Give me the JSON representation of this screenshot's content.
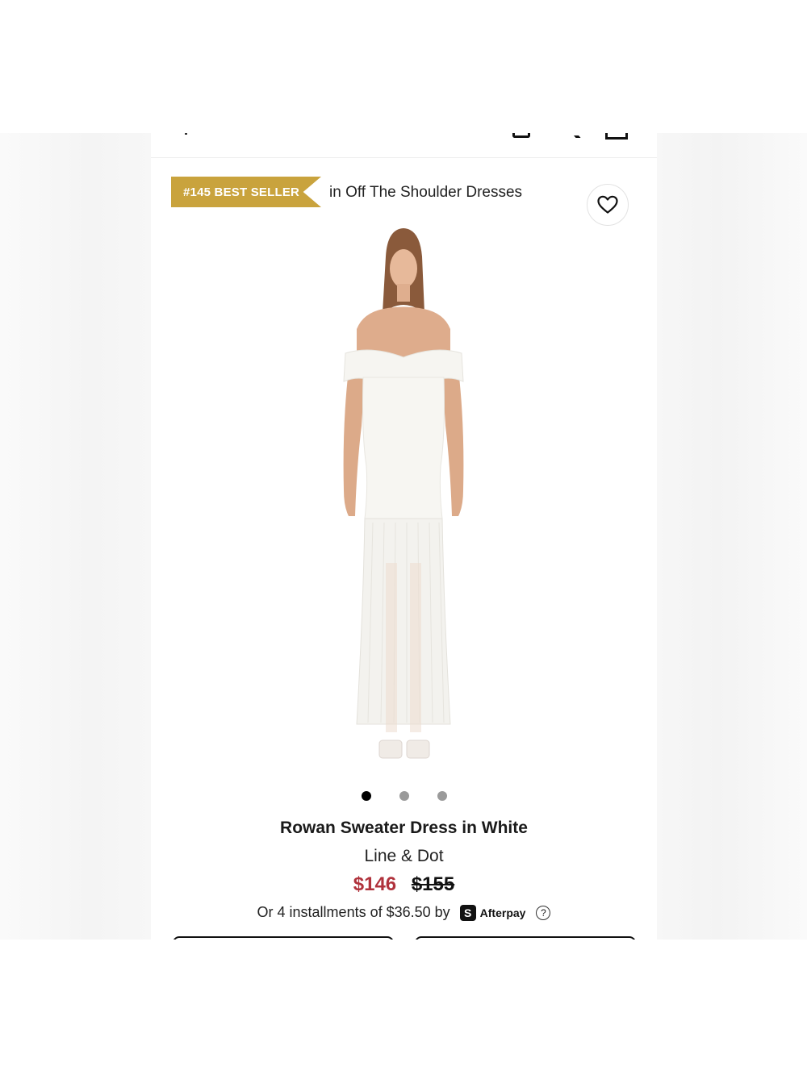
{
  "badge": {
    "rank_label": "#145 BEST SELLER",
    "category": "in Off The Shoulder Dresses",
    "color": "#c9a33d"
  },
  "icons": {
    "wishlist": "heart-icon",
    "help": "question-icon",
    "afterpay": "afterpay-logo"
  },
  "carousel": {
    "count": 3,
    "active_index": 0
  },
  "product": {
    "title": "Rowan Sweater Dress in White",
    "brand": "Line & Dot",
    "sale_price": "$146",
    "original_price": "$155",
    "sale_color": "#b0323c"
  },
  "payment": {
    "installments_text": "Or 4 installments of $36.50 by",
    "afterpay_mark": "S",
    "afterpay_label": "Afterpay",
    "help_glyph": "?"
  }
}
